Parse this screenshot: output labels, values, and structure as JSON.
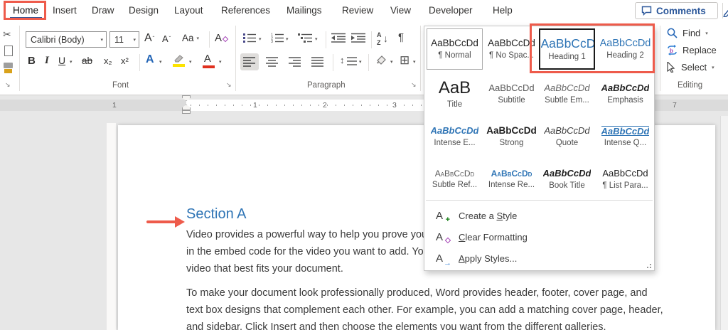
{
  "tabs": [
    "Home",
    "Insert",
    "Draw",
    "Design",
    "Layout",
    "References",
    "Mailings",
    "Review",
    "View",
    "Developer",
    "Help"
  ],
  "topbar": {
    "comments_label": "Comments"
  },
  "ribbon": {
    "font": {
      "group_label": "Font",
      "font_name": "Calibri (Body)",
      "font_size": "11",
      "grow_font": "A",
      "shrink_font": "A",
      "change_case": "Aa",
      "clear_format": "A",
      "bold": "B",
      "italic": "I",
      "underline": "U",
      "strikethrough": "ab",
      "subscript": "x₂",
      "superscript": "x²",
      "text_effects": "A",
      "font_color": "A"
    },
    "paragraph": {
      "group_label": "Paragraph",
      "sort_a": "A",
      "sort_z": "Z",
      "sort_arrow": "↓",
      "pilcrow": "¶",
      "line_spacing_arrow": "↕",
      "borders_glyph": "⊞"
    },
    "editing": {
      "group_label": "Editing",
      "find_label": "Find",
      "replace_label": "Replace",
      "select_label": "Select"
    }
  },
  "styles": {
    "cells": [
      {
        "sample": "AaBbCcDd",
        "label": "¶ Normal"
      },
      {
        "sample": "AaBbCcDd",
        "label": "¶ No Spac..."
      },
      {
        "sample": "AaBbCcDd",
        "label": "Heading 1"
      },
      {
        "sample": "AaBbCcDd",
        "label": "Heading 2"
      },
      {
        "sample": "AaB",
        "label": "Title"
      },
      {
        "sample": "AaBbCcDd",
        "label": "Subtitle"
      },
      {
        "sample": "AaBbCcDd",
        "label": "Subtle Em..."
      },
      {
        "sample": "AaBbCcDd",
        "label": "Emphasis"
      },
      {
        "sample": "AaBbCcDd",
        "label": "Intense E..."
      },
      {
        "sample": "AaBbCcDd",
        "label": "Strong"
      },
      {
        "sample": "AaBbCcDd",
        "label": "Quote"
      },
      {
        "sample": "AaBbCcDd",
        "label": "Intense Q..."
      },
      {
        "sample": "AaBbCcDd",
        "label": "Subtle Ref..."
      },
      {
        "sample": "AaBbCcDd",
        "label": "Intense Re..."
      },
      {
        "sample": "AaBbCcDd",
        "label": "Book Title"
      },
      {
        "sample": "AaBbCcDd",
        "label": "¶ List Para..."
      }
    ],
    "menu": [
      {
        "icon_letter": "A",
        "pre": "Create a ",
        "u": "S",
        "post": "tyle"
      },
      {
        "icon_letter": "A",
        "pre": "",
        "u": "C",
        "post": "lear Formatting"
      },
      {
        "icon_letter": "A",
        "pre": "",
        "u": "A",
        "post": "pply Styles..."
      }
    ]
  },
  "ruler": {
    "left_num": "1",
    "in1": "1",
    "in2": "2",
    "in3": "3",
    "right_num": "7"
  },
  "document": {
    "heading": "Section A",
    "para1_lines": [
      "Video provides a powerful way to help you prove you",
      "in the embed code for the video you want to add. You",
      "video that best fits your document."
    ],
    "para2_lines": [
      "To make your document look professionally produced, Word provides header, footer, cover page, and",
      "text box designs that complement each other. For example, you can add a matching cover page, header,",
      "and sidebar. Click Insert and then choose the elements you want from the different galleries."
    ]
  },
  "colors": {
    "annotation_red": "#EE5B4B",
    "word_blue": "#2B579A",
    "heading_blue": "#2E74B5",
    "highlight_yellow": "#FCE300",
    "font_color_red": "#E0301E"
  }
}
